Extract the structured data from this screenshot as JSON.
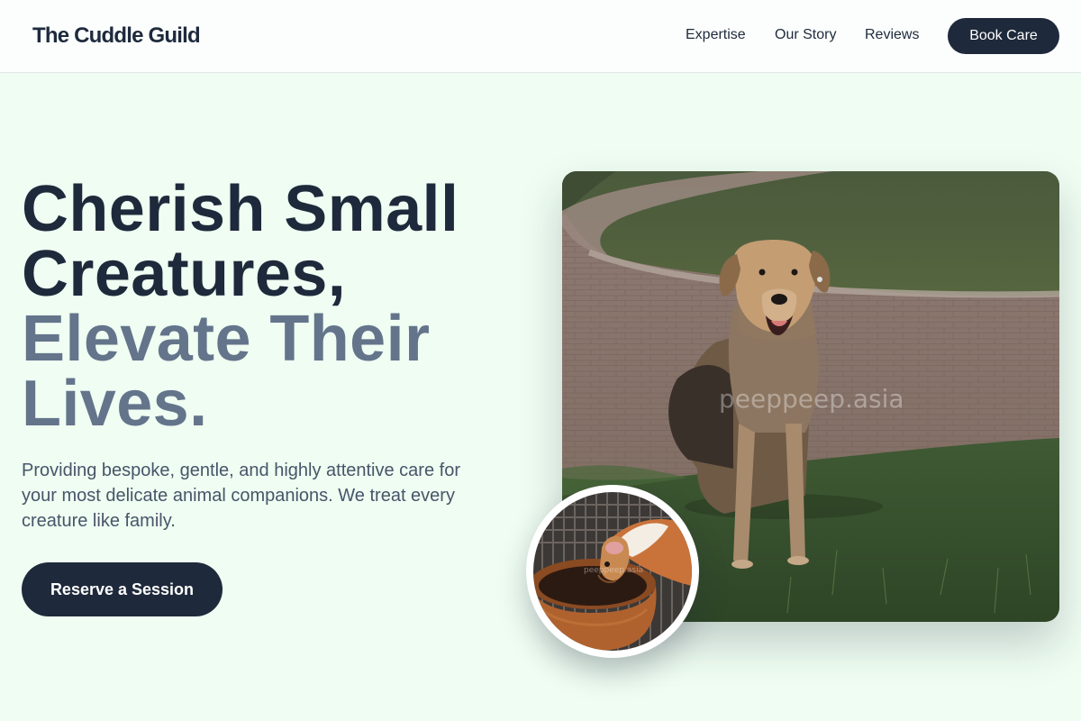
{
  "header": {
    "logo": "The Cuddle Guild",
    "nav": [
      "Expertise",
      "Our Story",
      "Reviews"
    ],
    "cta": "Book Care"
  },
  "hero": {
    "headline_dark": [
      "Cherish Small",
      "Creatures,"
    ],
    "headline_muted": [
      "Elevate Their",
      "Lives."
    ],
    "description": "Providing bespoke, gentle, and highly attentive care for your most delicate animal companions. We treat every creature like family.",
    "cta": "Reserve a Session"
  },
  "media": {
    "main_photo_watermark": "peeppeep.asia",
    "thumb_photo_watermark": "peeppeep.asia"
  },
  "colors": {
    "background": "#effdf2",
    "primary": "#1e293b",
    "muted_heading": "#64748b",
    "body_text": "#475569"
  }
}
